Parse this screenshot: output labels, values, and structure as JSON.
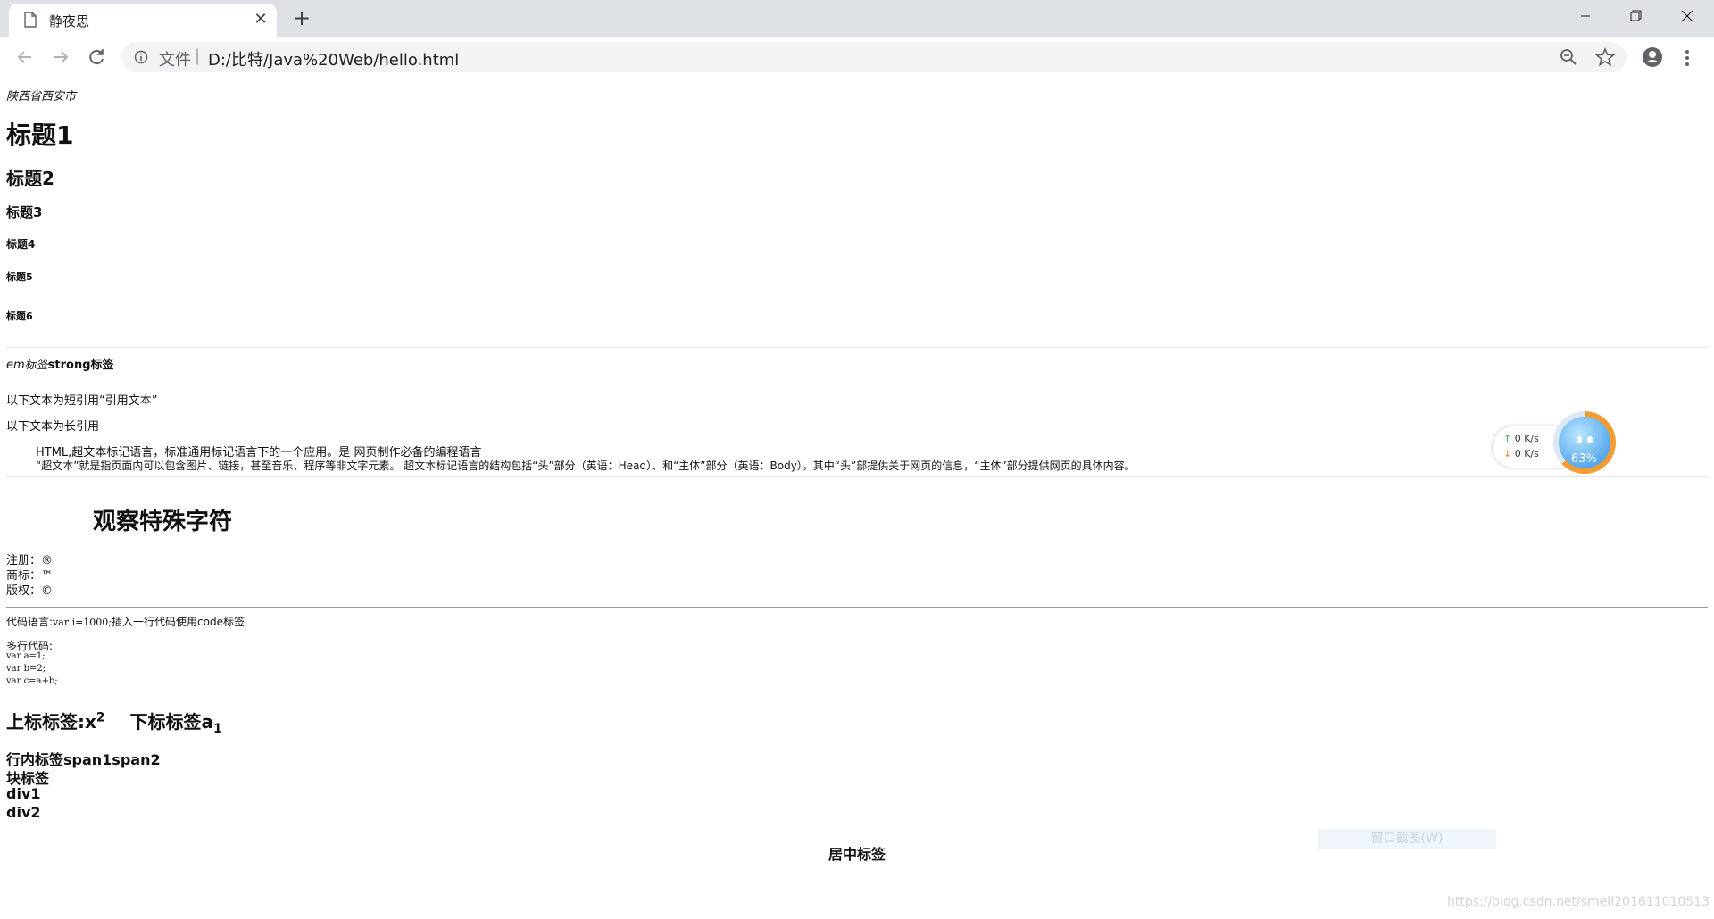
{
  "browser": {
    "tab_title": "静夜思",
    "new_tab_symbol": "+",
    "close_symbol": "✕",
    "scheme_label": "文件",
    "scheme_separator": "|",
    "url": "D:/比特/Java%20Web/hello.html"
  },
  "content": {
    "address": "陕西省西安市",
    "h1": "标题1",
    "h2": "标题2",
    "h3": "标题3",
    "h4": "标题4",
    "h5": "标题5",
    "h6": "标题6",
    "em_text": "em标签",
    "strong_text": "strong标签",
    "short_quote_prefix": "以下文本为短引用",
    "short_quote": "“引用文本”",
    "long_quote_label": "以下文本为长引用",
    "blockquote_line1": "HTML,超文本标记语言，标准通用标记语言下的一个应用。是 网页制作必备的编程语言",
    "blockquote_line2": "“超文本”就是指页面内可以包含图片、链接，甚至音乐、程序等非文字元素。 超文本标记语言的结构包括“头”部分（英语：Head）、和“主体”部分（英语：Body），其中“头”部提供关于网页的信息，“主体”部分提供网页的具体内容。",
    "special_title": "观察特殊字符",
    "special_registered": "注册：®",
    "special_trademark": "商标：™",
    "special_copyright": "版权：©",
    "code_prefix": "代码语言:",
    "code_inline": "var i=1000;",
    "code_suffix": "插入一行代码使用code标签",
    "multi_code_label": "多行代码:",
    "multi_code": "var a=1;\nvar b=2;\nvar c=a+b;",
    "sup_label": "上标标签:x",
    "sup_value": "2",
    "sub_label": "下标标签a",
    "sub_value": "1",
    "inline_line": "行内标签span1span2",
    "block_label": "块标签",
    "div1": "div1",
    "div2": "div2",
    "center_text": "居中标签"
  },
  "overlay": {
    "net_up": "0  K/s",
    "net_down": "0  K/s",
    "ball_percent": "63%",
    "ball_percent_value": 63,
    "snip_button": "窗口截图(W)",
    "watermark": "https://blog.csdn.net/smell201611010513"
  }
}
